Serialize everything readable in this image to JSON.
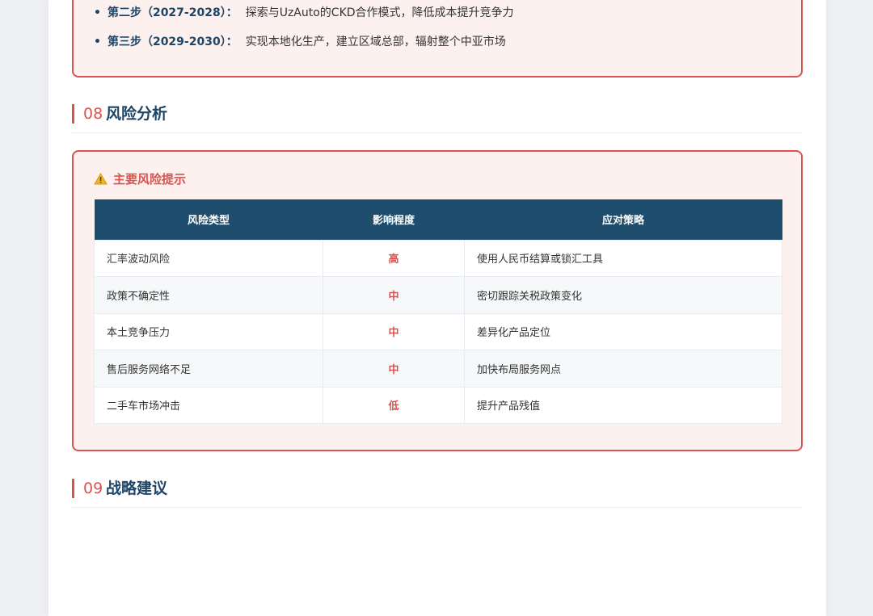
{
  "steps": [
    {
      "label": "第二步（2027-2028）：",
      "text": "探索与UzAuto的CKD合作模式，降低成本提升竞争力"
    },
    {
      "label": "第三步（2029-2030）：",
      "text": "实现本地化生产，建立区域总部，辐射整个中亚市场"
    }
  ],
  "section8": {
    "number": "08",
    "title": "风险分析"
  },
  "risk": {
    "title": "主要风险提示",
    "columns": [
      "风险类型",
      "影响程度",
      "应对策略"
    ],
    "rows": [
      {
        "type": "汇率波动风险",
        "level": "高",
        "strategy": "使用人民币结算或锁汇工具"
      },
      {
        "type": "政策不确定性",
        "level": "中",
        "strategy": "密切跟踪关税政策变化"
      },
      {
        "type": "本土竞争压力",
        "level": "中",
        "strategy": "差异化产品定位"
      },
      {
        "type": "售后服务网络不足",
        "level": "中",
        "strategy": "加快布局服务网点"
      },
      {
        "type": "二手车市场冲击",
        "level": "低",
        "strategy": "提升产品残值"
      }
    ]
  },
  "section9": {
    "number": "09",
    "title": "战略建议"
  },
  "colors": {
    "accent": "#d9534f",
    "navy": "#1e4466",
    "table_header": "#1e4d6e",
    "box_bg": "#fdf1f0"
  }
}
